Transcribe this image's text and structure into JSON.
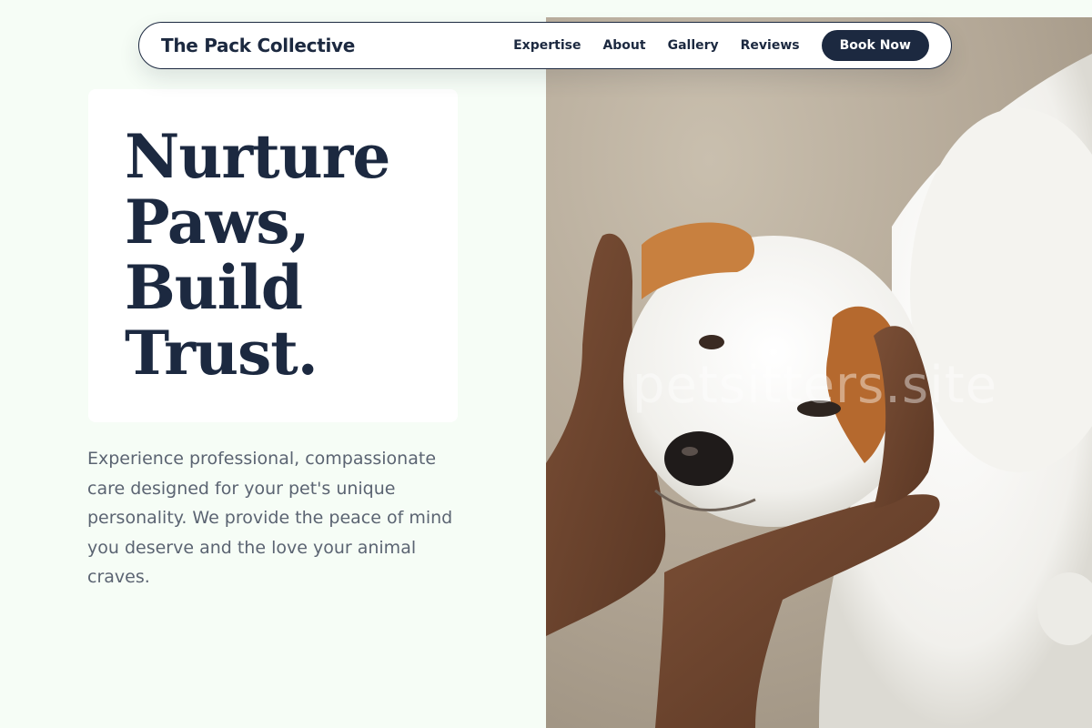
{
  "nav": {
    "brand": "The Pack Collective",
    "links": [
      "Expertise",
      "About",
      "Gallery",
      "Reviews"
    ],
    "cta": "Book Now"
  },
  "hero": {
    "title_lines": [
      "Nurture",
      "Paws,",
      "Build",
      "Trust."
    ],
    "description": "Experience professional, compassionate care designed for your pet's unique personality. We provide the peace of mind you deserve and the love your animal craves."
  },
  "image": {
    "subject": "white puppy with brown ears held in two hands",
    "watermark": "petsitters.site"
  },
  "colors": {
    "page_background": "#f6fdf6",
    "navy": "#1c2940",
    "body_text": "#5b6472",
    "card": "#ffffff"
  }
}
